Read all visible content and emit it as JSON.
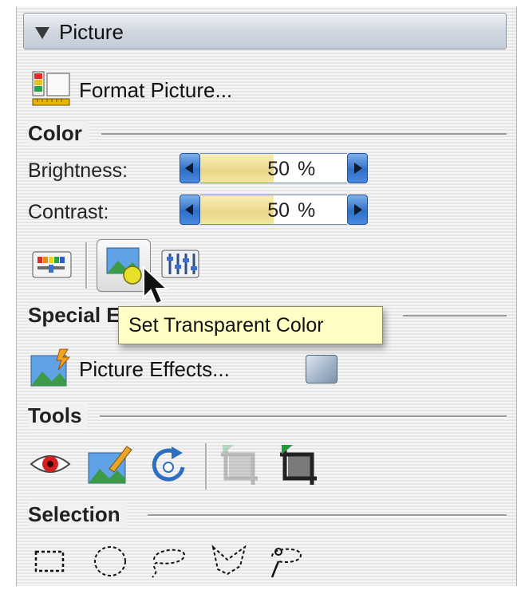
{
  "panel": {
    "title": "Picture",
    "format_picture_label": "Format Picture...",
    "format_picture_icon": "format-picture-icon"
  },
  "color": {
    "section_label": "Color",
    "brightness": {
      "label": "Brightness:",
      "value": "50",
      "unit": "%",
      "fill_fraction": 0.5
    },
    "contrast": {
      "label": "Contrast:",
      "value": "50",
      "unit": "%",
      "fill_fraction": 0.5
    },
    "buttons": [
      "recolor-icon",
      "set-transparent-color-icon",
      "image-adjustments-icon"
    ]
  },
  "special_effects": {
    "section_label": "Special Eff",
    "picture_effects_label": "Picture Effects...",
    "swatch_color": "#9fb1c6"
  },
  "tooltip": {
    "text": "Set Transparent Color"
  },
  "tools": {
    "section_label": "Tools",
    "buttons": [
      "red-eye-icon",
      "edit-picture-icon",
      "rotate-icon",
      "crop-icon-disabled",
      "crop-icon"
    ]
  },
  "selection": {
    "section_label": "Selection",
    "buttons": [
      "rectangle-marquee-icon",
      "oval-marquee-icon",
      "lasso-icon",
      "polygon-lasso-icon",
      "magic-wand-icon"
    ]
  },
  "colors": {
    "accent_blue": "#2e6fc8",
    "spinner_fill": "#ead788",
    "tooltip_bg": "#ffffc6",
    "red_eye": "#d42020"
  }
}
